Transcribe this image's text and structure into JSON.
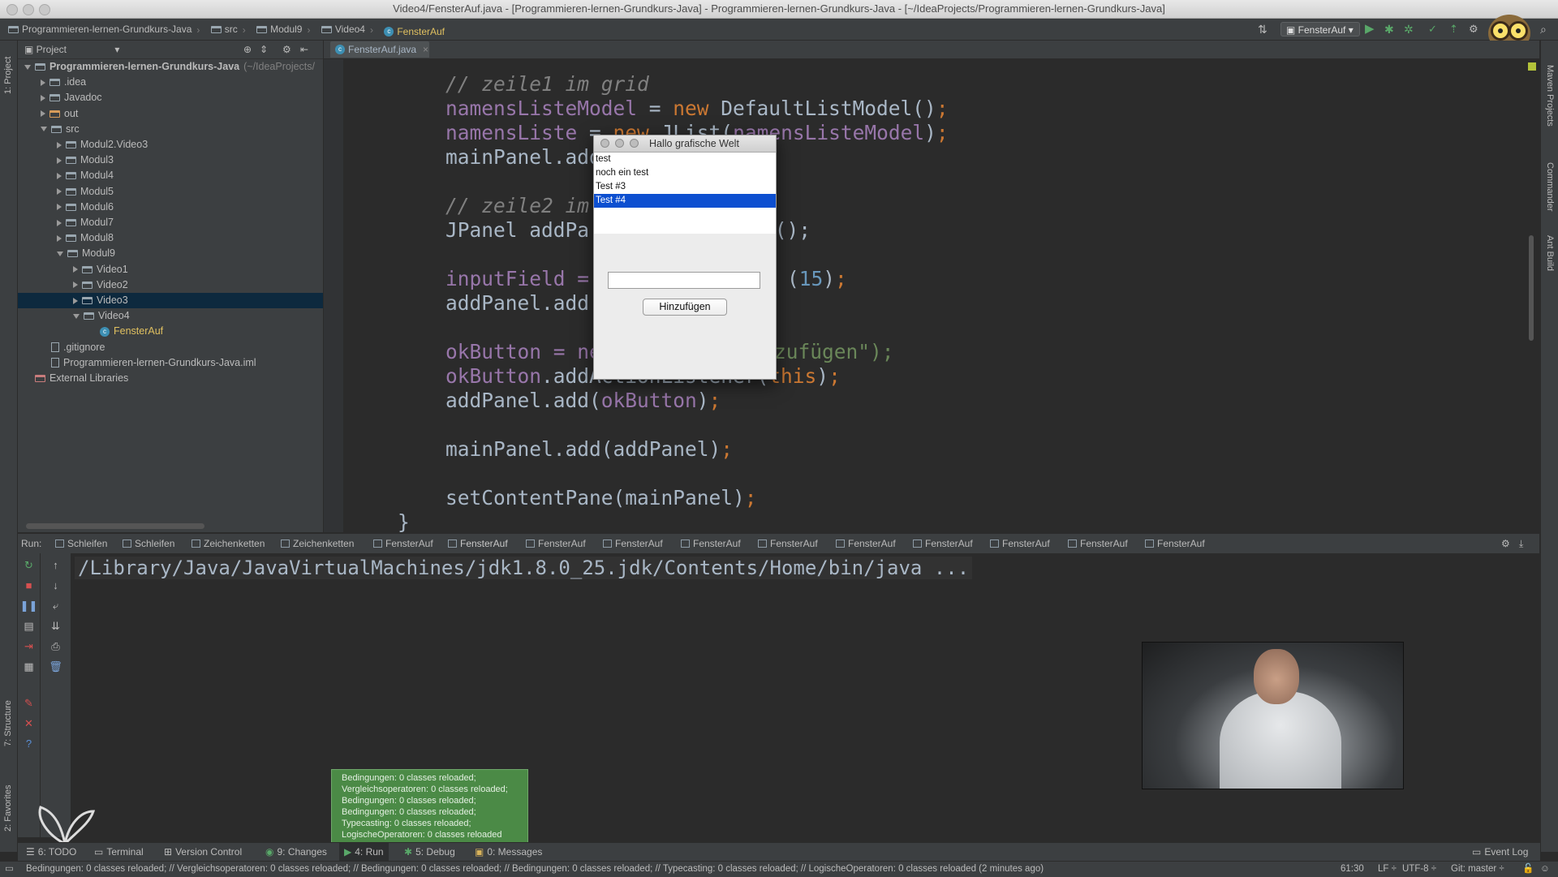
{
  "window": {
    "title": "Video4/FensterAuf.java - [Programmieren-lernen-Grundkurs-Java] - Programmieren-lernen-Grundkurs-Java - [~/IdeaProjects/Programmieren-lernen-Grundkurs-Java]"
  },
  "navbar": {
    "crumbs": [
      "Programmieren-lernen-Grundkurs-Java",
      "src",
      "Modul9",
      "Video4",
      "FensterAuf"
    ],
    "run_config": "FensterAuf"
  },
  "left_stripe": {
    "project": "1: Project",
    "structure": "7: Structure",
    "favorites": "2: Favorites"
  },
  "right_stripe": {
    "maven": "Maven Projects",
    "commander": "Commander",
    "ant": "Ant Build"
  },
  "project_panel": {
    "header": "Project",
    "tree": [
      {
        "label": "Programmieren-lernen-Grundkurs-Java",
        "suffix": "(~/IdeaProjects/",
        "indent": 0,
        "expanded": true,
        "type": "module"
      },
      {
        "label": ".idea",
        "indent": 1,
        "expanded": false,
        "type": "folder"
      },
      {
        "label": "Javadoc",
        "indent": 1,
        "expanded": false,
        "type": "folder"
      },
      {
        "label": "out",
        "indent": 1,
        "expanded": false,
        "type": "folder"
      },
      {
        "label": "src",
        "indent": 1,
        "expanded": true,
        "type": "folder"
      },
      {
        "label": "Modul2.Video3",
        "indent": 2,
        "expanded": false,
        "type": "package"
      },
      {
        "label": "Modul3",
        "indent": 2,
        "expanded": false,
        "type": "package"
      },
      {
        "label": "Modul4",
        "indent": 2,
        "expanded": false,
        "type": "package"
      },
      {
        "label": "Modul5",
        "indent": 2,
        "expanded": false,
        "type": "package"
      },
      {
        "label": "Modul6",
        "indent": 2,
        "expanded": false,
        "type": "package"
      },
      {
        "label": "Modul7",
        "indent": 2,
        "expanded": false,
        "type": "package"
      },
      {
        "label": "Modul8",
        "indent": 2,
        "expanded": false,
        "type": "package"
      },
      {
        "label": "Modul9",
        "indent": 2,
        "expanded": true,
        "type": "package"
      },
      {
        "label": "Video1",
        "indent": 3,
        "expanded": false,
        "type": "package"
      },
      {
        "label": "Video2",
        "indent": 3,
        "expanded": false,
        "type": "package"
      },
      {
        "label": "Video3",
        "indent": 3,
        "expanded": false,
        "type": "package",
        "selected": true
      },
      {
        "label": "Video4",
        "indent": 3,
        "expanded": true,
        "type": "package"
      },
      {
        "label": "FensterAuf",
        "indent": 4,
        "type": "class"
      },
      {
        "label": ".gitignore",
        "indent": 1,
        "type": "file"
      },
      {
        "label": "Programmieren-lernen-Grundkurs-Java.iml",
        "indent": 1,
        "type": "file"
      },
      {
        "label": "External Libraries",
        "indent": 0,
        "type": "lib"
      }
    ]
  },
  "editor": {
    "tab": "FensterAuf.java",
    "lines": [
      "// zeile1 im grid",
      "namensListeModel = new DefaultListModel();",
      "namensListe = new JList(namensListeModel);",
      "mainPanel.add",
      "// zeile2 im",
      "JPanel addPa",
      "l();",
      "inputField =",
      "(15);",
      "addPanel.add",
      "okButton = ne",
      "zufügen\");",
      "okButton.addActionListener(this);",
      "addPanel.add(okButton);",
      "mainPanel.add(addPanel);",
      "setContentPane(mainPanel);",
      "}"
    ]
  },
  "dialog": {
    "title": "Hallo grafische Welt",
    "list_items": [
      "test",
      "noch ein test",
      "Test #3",
      "Test #4"
    ],
    "selected_index": 3,
    "input_value": "",
    "button_label": "Hinzufügen"
  },
  "run_panel": {
    "label": "Run:",
    "tabs": [
      "Schleifen",
      "Schleifen",
      "Zeichenketten",
      "Zeichenketten",
      "FensterAuf",
      "FensterAuf",
      "FensterAuf",
      "FensterAuf",
      "FensterAuf",
      "FensterAuf",
      "FensterAuf",
      "FensterAuf",
      "FensterAuf",
      "FensterAuf",
      "FensterAuf"
    ],
    "active_tab_index": 5,
    "console_line": "/Library/Java/JavaVirtualMachines/jdk1.8.0_25.jdk/Contents/Home/bin/java ..."
  },
  "notification": {
    "lines": [
      "Bedingungen: 0 classes reloaded;",
      "Vergleichsoperatoren: 0 classes reloaded;",
      "Bedingungen: 0 classes reloaded;",
      "Bedingungen: 0 classes reloaded;",
      "Typecasting: 0 classes reloaded;",
      "LogischeOperatoren: 0 classes reloaded"
    ]
  },
  "tool_windows": {
    "todo": "6: TODO",
    "terminal": "Terminal",
    "vcs": "Version Control",
    "changes": "9: Changes",
    "run": "4: Run",
    "debug": "5: Debug",
    "messages": "0: Messages",
    "event_log": "Event Log"
  },
  "status_bar": {
    "message": "Bedingungen: 0 classes reloaded; // Vergleichsoperatoren: 0 classes reloaded; // Bedingungen: 0 classes reloaded; // Bedingungen: 0 classes reloaded; // Typecasting: 0 classes reloaded; // LogischeOperatoren: 0 classes reloaded (2 minutes ago)",
    "position": "61:30",
    "line_sep": "LF",
    "encoding": "UTF-8",
    "git": "Git: master"
  }
}
